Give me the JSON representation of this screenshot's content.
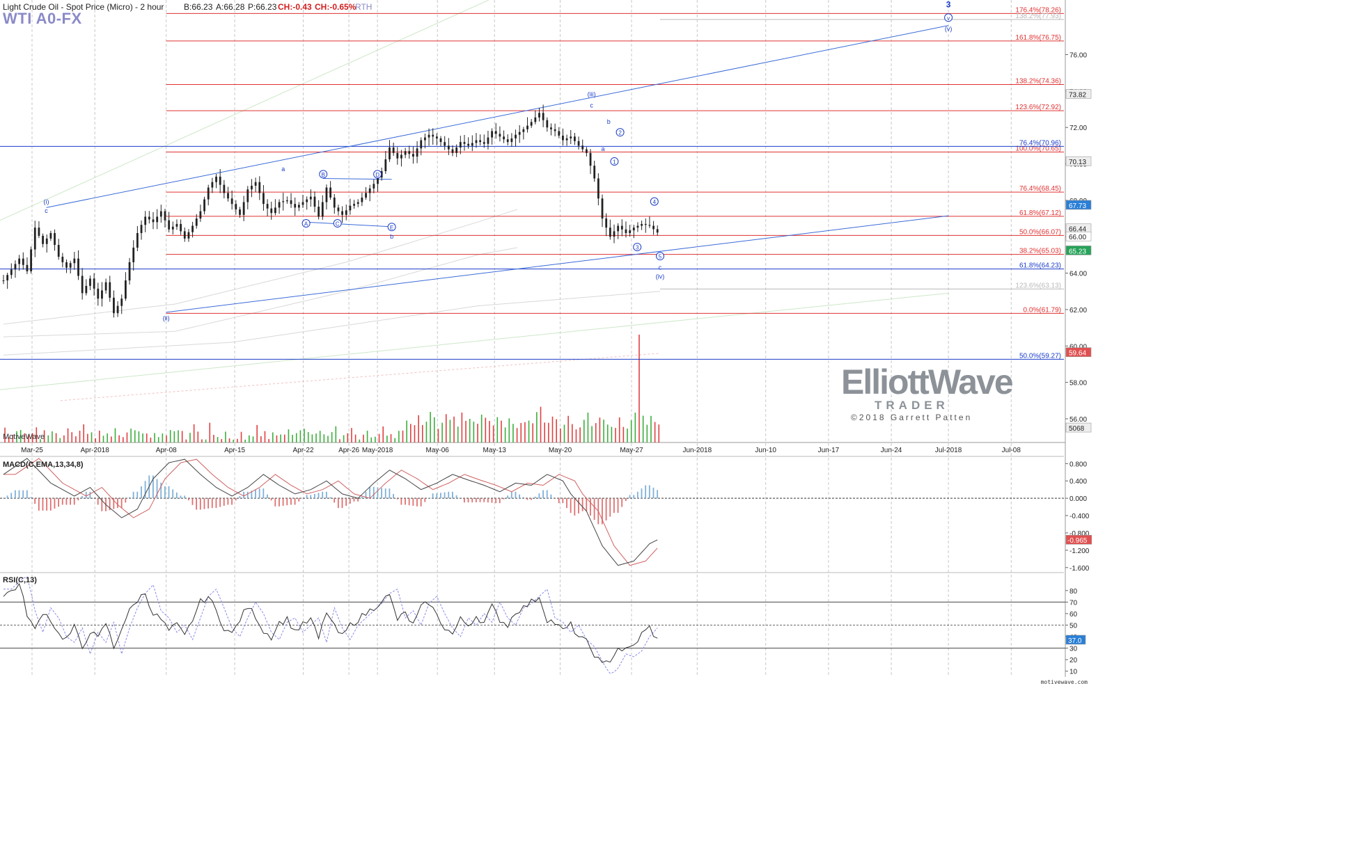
{
  "header": {
    "title": "Light Crude Oil - Spot Price (Micro) - 2 hour",
    "bid": "B:66.23",
    "ask": "A:66.28",
    "price": "P:66.23",
    "change": "CH:-0.43",
    "change_pct": "CH:-0.65%",
    "session": "RTH",
    "ticker": "WTI A0-FX"
  },
  "branding": {
    "watermark": "MotiveWave",
    "logo_line1": "ElliottWave",
    "logo_line2": "TRADER",
    "copyright": "©2018 Garrett Patten",
    "footer": "motivewave.com"
  },
  "colors": {
    "fib_red": "#e03030",
    "wave_blue": "#1a3cc8",
    "trend_blue": "#3a6ad8",
    "candle": "#222222",
    "vol_green": "#3cae3c",
    "vol_red": "#e04040",
    "macd_up": "#7fb0d8",
    "macd_down": "#e07070",
    "badge_blue": "#2a7fd6",
    "badge_green": "#27a35a",
    "badge_red": "#e05050",
    "badge_gray": "#eeeeee"
  },
  "chart_data": [
    {
      "type": "candlestick",
      "title": "Light Crude Oil - Spot Price (Micro) - 2 hour",
      "x_labels": [
        "Mar-25",
        "Apr-2018",
        "Apr-08",
        "Apr-15",
        "Apr-22",
        "Apr-26",
        "May-2018",
        "May-06",
        "May-13",
        "May-20",
        "May-27",
        "Jun-2018",
        "Jun-10",
        "Jun-17",
        "Jun-24",
        "Jul-2018",
        "Jul-08"
      ],
      "y_ticks": [
        "76.00",
        "74.00",
        "72.00",
        "70.00",
        "68.00",
        "66.00",
        "64.00",
        "62.00",
        "60.00",
        "58.00",
        "56.00"
      ],
      "ylim": [
        54.7,
        79.0
      ],
      "price_path": [
        [
          0,
          63.6
        ],
        [
          4,
          64.8
        ],
        [
          6,
          64.1
        ],
        [
          8,
          66.5
        ],
        [
          10,
          65.6
        ],
        [
          12,
          66.2
        ],
        [
          14,
          64.9
        ],
        [
          16,
          64.3
        ],
        [
          18,
          64.8
        ],
        [
          20,
          62.9
        ],
        [
          22,
          63.7
        ],
        [
          24,
          62.6
        ],
        [
          26,
          63.5
        ],
        [
          28,
          61.8
        ],
        [
          30,
          62.6
        ],
        [
          32,
          64.6
        ],
        [
          34,
          66.2
        ],
        [
          36,
          67.1
        ],
        [
          38,
          66.8
        ],
        [
          40,
          67.4
        ],
        [
          42,
          66.4
        ],
        [
          44,
          66.7
        ],
        [
          46,
          65.9
        ],
        [
          48,
          66.6
        ],
        [
          50,
          67.4
        ],
        [
          52,
          68.7
        ],
        [
          54,
          69.3
        ],
        [
          56,
          68.4
        ],
        [
          58,
          67.8
        ],
        [
          60,
          67.2
        ],
        [
          62,
          68.6
        ],
        [
          64,
          69.0
        ],
        [
          66,
          67.8
        ],
        [
          68,
          67.3
        ],
        [
          70,
          67.9
        ],
        [
          72,
          68.0
        ],
        [
          74,
          67.6
        ],
        [
          76,
          67.9
        ],
        [
          78,
          68.2
        ],
        [
          80,
          67.1
        ],
        [
          82,
          68.7
        ],
        [
          84,
          67.6
        ],
        [
          86,
          67.2
        ],
        [
          88,
          67.7
        ],
        [
          90,
          67.9
        ],
        [
          92,
          68.4
        ],
        [
          94,
          68.9
        ],
        [
          96,
          69.6
        ],
        [
          98,
          70.9
        ],
        [
          100,
          70.3
        ],
        [
          102,
          70.7
        ],
        [
          104,
          70.4
        ],
        [
          106,
          71.3
        ],
        [
          108,
          71.6
        ],
        [
          110,
          71.4
        ],
        [
          112,
          71.0
        ],
        [
          114,
          70.6
        ],
        [
          116,
          71.2
        ],
        [
          118,
          71.0
        ],
        [
          120,
          71.3
        ],
        [
          122,
          71.1
        ],
        [
          124,
          71.8
        ],
        [
          126,
          71.5
        ],
        [
          128,
          71.2
        ],
        [
          130,
          71.6
        ],
        [
          132,
          71.9
        ],
        [
          134,
          72.3
        ],
        [
          136,
          72.8
        ],
        [
          138,
          72.0
        ],
        [
          140,
          71.8
        ],
        [
          142,
          71.3
        ],
        [
          144,
          71.5
        ],
        [
          146,
          71.0
        ],
        [
          148,
          70.6
        ],
        [
          150,
          69.2
        ],
        [
          152,
          67.0
        ],
        [
          154,
          66.0
        ],
        [
          156,
          66.6
        ],
        [
          158,
          66.2
        ],
        [
          160,
          66.5
        ],
        [
          162,
          66.7
        ],
        [
          164,
          66.6
        ],
        [
          166,
          66.23
        ]
      ],
      "n_bars": 167,
      "fib_levels": [
        {
          "label": "176.4%(78.26)",
          "price": 78.26,
          "color": "red"
        },
        {
          "label": "161.8%(76.75)",
          "price": 76.75,
          "color": "red"
        },
        {
          "label": "138.2%(74.36)",
          "price": 74.36,
          "color": "red"
        },
        {
          "label": "123.6%(72.92)",
          "price": 72.92,
          "color": "red"
        },
        {
          "label": "100.0%(70.65)",
          "price": 70.65,
          "color": "red"
        },
        {
          "label": "76.4%(68.45)",
          "price": 68.45,
          "color": "red"
        },
        {
          "label": "61.8%(67.12)",
          "price": 67.12,
          "color": "red"
        },
        {
          "label": "50.0%(66.07)",
          "price": 66.07,
          "color": "red"
        },
        {
          "label": "38.2%(65.03)",
          "price": 65.03,
          "color": "red"
        },
        {
          "label": "0.0%(61.79)",
          "price": 61.79,
          "color": "red"
        },
        {
          "label": "76.4%(70.96)",
          "price": 70.96,
          "color": "blue"
        },
        {
          "label": "61.8%(64.23)",
          "price": 64.23,
          "color": "blue"
        },
        {
          "label": "50.0%(59.27)",
          "price": 59.27,
          "color": "blue"
        },
        {
          "label": "123.6%(63.13)",
          "price": 63.13,
          "color": "gray"
        },
        {
          "label": "138.2%(77.93)",
          "price": 77.93,
          "color": "gray"
        }
      ],
      "price_badges": [
        {
          "text": "73.82",
          "price": 73.82,
          "style": "gray"
        },
        {
          "text": "70.13",
          "price": 70.13,
          "style": "gray"
        },
        {
          "text": "67.73",
          "price": 67.73,
          "style": "blue"
        },
        {
          "text": "66.44",
          "price": 66.44,
          "style": "gray"
        },
        {
          "text": "66.00",
          "price": 66.0,
          "style": "plain"
        },
        {
          "text": "65.23",
          "price": 65.23,
          "style": "green"
        },
        {
          "text": "59.64",
          "price": 59.64,
          "style": "red"
        },
        {
          "text": "5068",
          "price": 55.5,
          "style": "gray"
        }
      ],
      "wave_labels": [
        {
          "text": "(i)",
          "bar": 15,
          "price": 67.8,
          "circle": false
        },
        {
          "text": "c",
          "bar": 15,
          "price": 67.3,
          "circle": false
        },
        {
          "text": "(ii)",
          "bar": 57,
          "price": 61.4,
          "circle": false
        },
        {
          "text": "a",
          "bar": 98,
          "price": 69.6,
          "circle": false
        },
        {
          "text": "A",
          "bar": 106,
          "price": 66.6,
          "circle": true
        },
        {
          "text": "B",
          "bar": 112,
          "price": 69.3,
          "circle": true
        },
        {
          "text": "C",
          "bar": 117,
          "price": 66.6,
          "circle": true
        },
        {
          "text": "D",
          "bar": 131,
          "price": 69.3,
          "circle": true
        },
        {
          "text": "E",
          "bar": 136,
          "price": 66.4,
          "circle": true
        },
        {
          "text": "b",
          "bar": 136,
          "price": 65.9,
          "circle": false
        },
        {
          "text": "(iii)",
          "bar": 206,
          "price": 73.7,
          "circle": false
        },
        {
          "text": "c",
          "bar": 206,
          "price": 73.1,
          "circle": false
        },
        {
          "text": "b",
          "bar": 212,
          "price": 72.2,
          "circle": false
        },
        {
          "text": "2",
          "bar": 216,
          "price": 71.6,
          "circle": true
        },
        {
          "text": "a",
          "bar": 210,
          "price": 70.7,
          "circle": false
        },
        {
          "text": "1",
          "bar": 214,
          "price": 70.0,
          "circle": true
        },
        {
          "text": "4",
          "bar": 228,
          "price": 67.8,
          "circle": true
        },
        {
          "text": "3",
          "bar": 222,
          "price": 65.3,
          "circle": true
        },
        {
          "text": "5",
          "bar": 230,
          "price": 64.8,
          "circle": true
        },
        {
          "text": "c",
          "bar": 230,
          "price": 64.2,
          "circle": false
        },
        {
          "text": "(iv)",
          "bar": 230,
          "price": 63.7,
          "circle": false
        },
        {
          "text": "3",
          "bar": 331,
          "price": 78.6,
          "circle": false
        },
        {
          "text": "v",
          "bar": 331,
          "price": 77.9,
          "circle": true
        },
        {
          "text": "(v)",
          "bar": 331,
          "price": 77.3,
          "circle": false
        }
      ]
    },
    {
      "type": "line",
      "title": "MACD(C,EMA,13,34,8)",
      "y_ticks": [
        "0.800",
        "0.400",
        "0.000",
        "-0.400",
        "-0.800",
        "-1.200",
        "-1.600"
      ],
      "ylim": [
        -1.7,
        0.95
      ],
      "last_value": "-0.965",
      "macd_path": [
        [
          0,
          0.55
        ],
        [
          6,
          0.92
        ],
        [
          12,
          0.35
        ],
        [
          18,
          0.05
        ],
        [
          22,
          0.25
        ],
        [
          26,
          -0.15
        ],
        [
          30,
          -0.45
        ],
        [
          34,
          -0.25
        ],
        [
          38,
          0.45
        ],
        [
          42,
          0.82
        ],
        [
          46,
          0.9
        ],
        [
          50,
          0.55
        ],
        [
          54,
          0.25
        ],
        [
          58,
          0.05
        ],
        [
          62,
          0.25
        ],
        [
          66,
          0.55
        ],
        [
          70,
          0.3
        ],
        [
          74,
          0.1
        ],
        [
          78,
          0.2
        ],
        [
          82,
          0.4
        ],
        [
          86,
          0.1
        ],
        [
          90,
          0.0
        ],
        [
          94,
          0.35
        ],
        [
          98,
          0.65
        ],
        [
          102,
          0.45
        ],
        [
          106,
          0.2
        ],
        [
          110,
          0.35
        ],
        [
          114,
          0.55
        ],
        [
          118,
          0.42
        ],
        [
          122,
          0.3
        ],
        [
          126,
          0.15
        ],
        [
          130,
          0.35
        ],
        [
          134,
          0.3
        ],
        [
          138,
          0.55
        ],
        [
          142,
          0.4
        ],
        [
          144,
          0.1
        ],
        [
          148,
          -0.3
        ],
        [
          152,
          -1.1
        ],
        [
          156,
          -1.55
        ],
        [
          160,
          -1.45
        ],
        [
          164,
          -1.05
        ],
        [
          166,
          -0.96
        ]
      ],
      "signal_lag": 3
    },
    {
      "type": "line",
      "title": "RSI(C,13)",
      "y_ticks": [
        "80",
        "70",
        "60",
        "50",
        "40",
        "30",
        "20",
        "10"
      ],
      "ylim": [
        5,
        95
      ],
      "levels": [
        70,
        50,
        30
      ],
      "last_value": "37.0",
      "rsi_path": [
        [
          0,
          75
        ],
        [
          4,
          85
        ],
        [
          6,
          60
        ],
        [
          8,
          45
        ],
        [
          10,
          62
        ],
        [
          12,
          55
        ],
        [
          14,
          42
        ],
        [
          16,
          38
        ],
        [
          18,
          48
        ],
        [
          20,
          30
        ],
        [
          22,
          45
        ],
        [
          24,
          38
        ],
        [
          26,
          52
        ],
        [
          28,
          30
        ],
        [
          30,
          48
        ],
        [
          32,
          62
        ],
        [
          34,
          72
        ],
        [
          36,
          78
        ],
        [
          38,
          60
        ],
        [
          40,
          55
        ],
        [
          42,
          45
        ],
        [
          44,
          50
        ],
        [
          46,
          40
        ],
        [
          48,
          55
        ],
        [
          50,
          70
        ],
        [
          52,
          75
        ],
        [
          54,
          62
        ],
        [
          56,
          48
        ],
        [
          58,
          42
        ],
        [
          60,
          55
        ],
        [
          62,
          66
        ],
        [
          64,
          58
        ],
        [
          66,
          45
        ],
        [
          68,
          40
        ],
        [
          70,
          52
        ],
        [
          72,
          55
        ],
        [
          74,
          45
        ],
        [
          76,
          50
        ],
        [
          78,
          55
        ],
        [
          80,
          38
        ],
        [
          82,
          62
        ],
        [
          84,
          48
        ],
        [
          86,
          40
        ],
        [
          88,
          50
        ],
        [
          90,
          55
        ],
        [
          92,
          60
        ],
        [
          94,
          65
        ],
        [
          96,
          72
        ],
        [
          98,
          75
        ],
        [
          100,
          55
        ],
        [
          102,
          60
        ],
        [
          104,
          50
        ],
        [
          106,
          65
        ],
        [
          108,
          70
        ],
        [
          110,
          58
        ],
        [
          112,
          48
        ],
        [
          114,
          42
        ],
        [
          116,
          55
        ],
        [
          118,
          50
        ],
        [
          120,
          58
        ],
        [
          122,
          52
        ],
        [
          124,
          66
        ],
        [
          126,
          55
        ],
        [
          128,
          50
        ],
        [
          130,
          62
        ],
        [
          132,
          65
        ],
        [
          134,
          70
        ],
        [
          136,
          75
        ],
        [
          138,
          55
        ],
        [
          140,
          52
        ],
        [
          142,
          45
        ],
        [
          144,
          50
        ],
        [
          146,
          40
        ],
        [
          148,
          35
        ],
        [
          150,
          25
        ],
        [
          152,
          15
        ],
        [
          154,
          20
        ],
        [
          156,
          30
        ],
        [
          158,
          28
        ],
        [
          160,
          32
        ],
        [
          162,
          42
        ],
        [
          164,
          48
        ],
        [
          166,
          37
        ]
      ]
    }
  ]
}
